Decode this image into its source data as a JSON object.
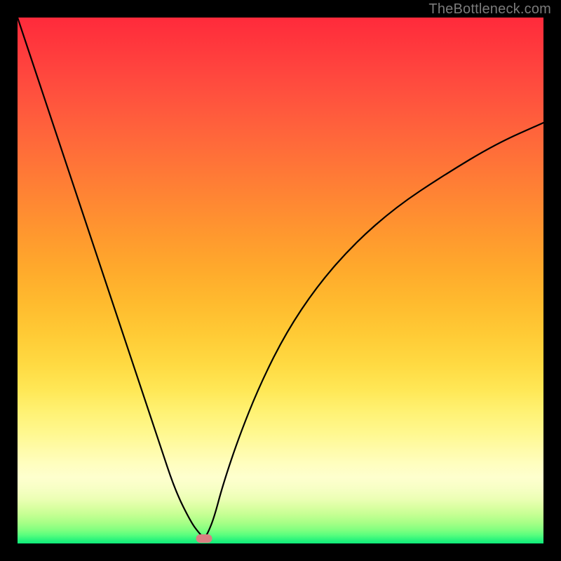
{
  "watermark": "TheBottleneck.com",
  "colors": {
    "page_bg": "#000000",
    "curve": "#000000",
    "marker": "#d97f82",
    "watermark": "#7b7b7b"
  },
  "chart_data": {
    "type": "line",
    "title": "",
    "xlabel": "",
    "ylabel": "",
    "xlim": [
      0,
      100
    ],
    "ylim": [
      0,
      100
    ],
    "grid": false,
    "legend": false,
    "background_gradient": {
      "orientation": "vertical",
      "stops": [
        {
          "pos": 0,
          "color": "#ff2a3b"
        },
        {
          "pos": 50,
          "color": "#ffaa2c"
        },
        {
          "pos": 82,
          "color": "#fff88f"
        },
        {
          "pos": 100,
          "color": "#0dea79"
        }
      ]
    },
    "series": [
      {
        "name": "bottleneck-curve",
        "x": [
          0,
          3,
          6,
          9,
          12,
          15,
          18,
          21,
          24,
          27,
          30,
          33,
          34.5,
          35.5,
          36.2,
          37.4,
          39,
          42,
          46,
          51,
          57,
          64,
          72,
          81,
          91,
          100
        ],
        "y": [
          100,
          91,
          82,
          73,
          64,
          55,
          46,
          37,
          28,
          19,
          10,
          4,
          2,
          1,
          2,
          5,
          11,
          20,
          30,
          40,
          49,
          57,
          64,
          70,
          76,
          80
        ]
      }
    ],
    "annotations": [
      {
        "type": "marker",
        "name": "optimum-marker",
        "x": 35.5,
        "y": 1,
        "shape": "rounded-rect",
        "color": "#d97f82"
      }
    ]
  }
}
